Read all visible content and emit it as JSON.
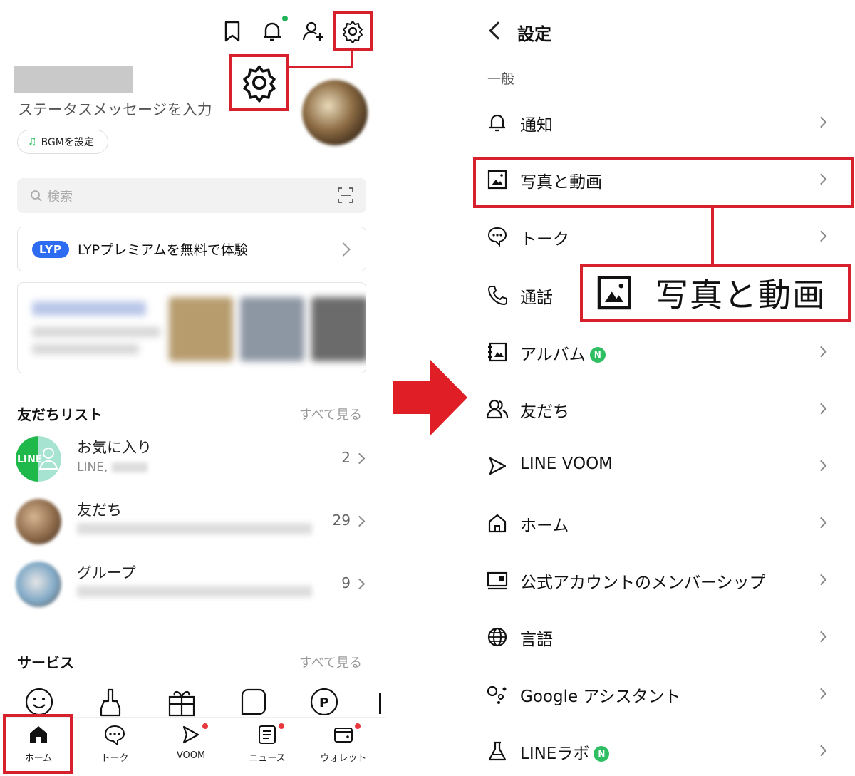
{
  "left": {
    "header_icons": [
      "bookmark-icon",
      "bell-icon",
      "add-friend-icon",
      "settings-gear-icon"
    ],
    "status_message_placeholder": "ステータスメッセージを入力",
    "bgm_label": "BGMを設定",
    "search_placeholder": "検索",
    "lyp_logo": "LYP",
    "lyp_text": "LYPプレミアムを無料で体験",
    "friends_section": {
      "title": "友だちリスト",
      "see_all": "すべて見る",
      "rows": [
        {
          "title": "お気に入り",
          "sub": "LINE,",
          "count": "2"
        },
        {
          "title": "友だち",
          "sub": "",
          "count": "29"
        },
        {
          "title": "グループ",
          "sub": "",
          "count": "9"
        }
      ]
    },
    "services_section": {
      "title": "サービス",
      "see_all": "すべて見る"
    },
    "tabs": [
      {
        "label": "ホーム",
        "icon": "home-icon"
      },
      {
        "label": "トーク",
        "icon": "chat-icon"
      },
      {
        "label": "VOOM",
        "icon": "voom-icon"
      },
      {
        "label": "ニュース",
        "icon": "news-icon"
      },
      {
        "label": "ウォレット",
        "icon": "wallet-icon"
      }
    ],
    "line_logo_text": "LINE"
  },
  "right": {
    "title": "設定",
    "section_general": "一般",
    "rows": [
      {
        "label": "通知",
        "icon": "bell-icon",
        "new": false
      },
      {
        "label": "写真と動画",
        "icon": "photo-icon",
        "new": false
      },
      {
        "label": "トーク",
        "icon": "chat-bubble-icon",
        "new": false
      },
      {
        "label": "通話",
        "icon": "phone-icon",
        "new": false
      },
      {
        "label": "アルバム",
        "icon": "album-icon",
        "new": true
      },
      {
        "label": "友だち",
        "icon": "friends-icon",
        "new": false
      },
      {
        "label": "LINE VOOM",
        "icon": "voom-icon",
        "new": false
      },
      {
        "label": "ホーム",
        "icon": "home-icon",
        "new": false
      },
      {
        "label": "公式アカウントのメンバーシップ",
        "icon": "membership-card-icon",
        "new": false
      },
      {
        "label": "言語",
        "icon": "globe-icon",
        "new": false
      },
      {
        "label": "Google アシスタント",
        "icon": "google-assistant-icon",
        "new": false
      },
      {
        "label": "LINEラボ",
        "icon": "flask-icon",
        "new": true
      }
    ],
    "new_badge": "N",
    "zoom_label": "写真と動画"
  },
  "colors": {
    "highlight_red": "#d6202b",
    "arrow_red": "#e01e26",
    "new_green": "#2fbf62",
    "lyp_blue": "#2d6bf0",
    "notification_dot": "#22b35a",
    "tab_dot": "#e8383d"
  }
}
